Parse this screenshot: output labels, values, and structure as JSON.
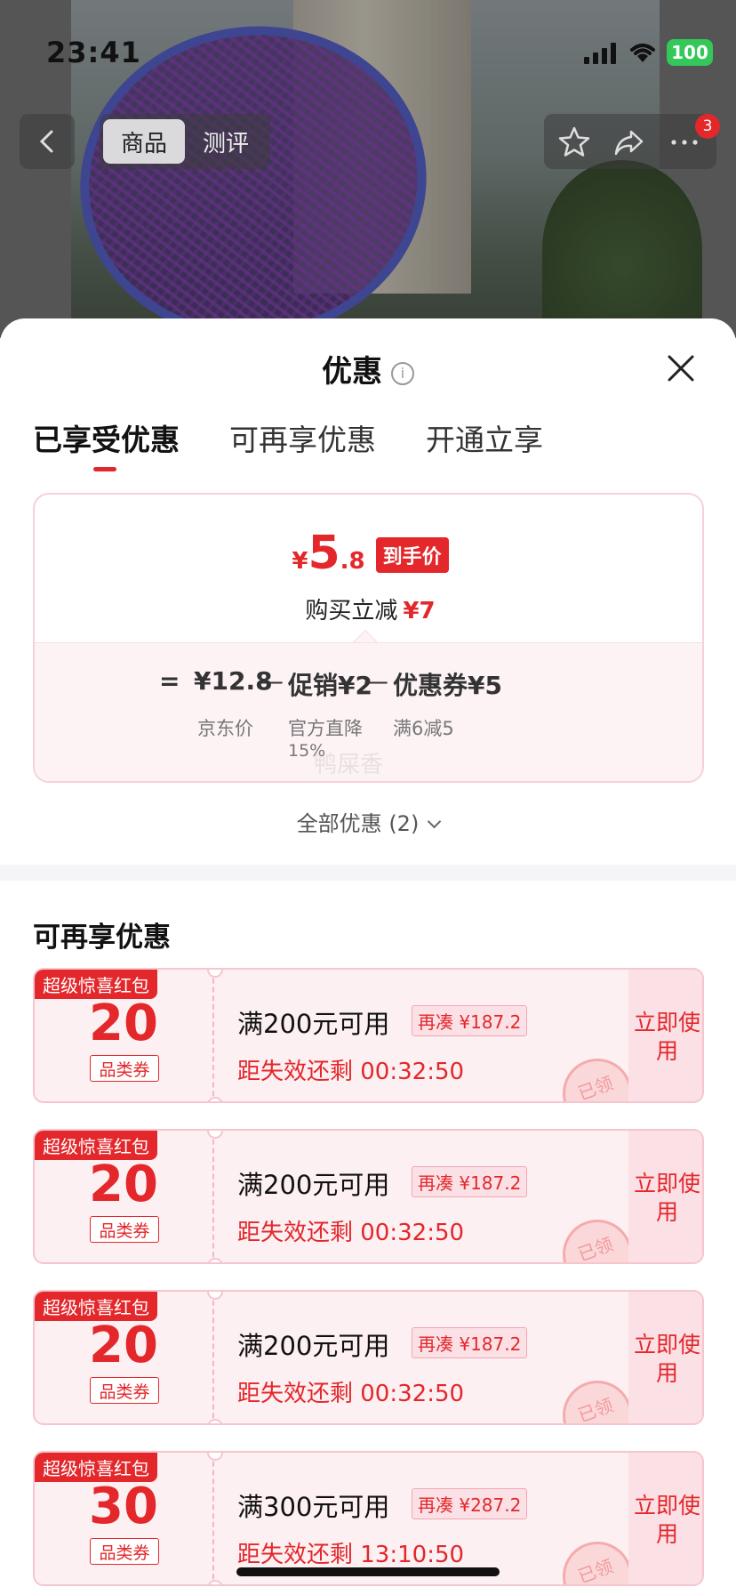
{
  "status_bar": {
    "time": "23:41",
    "battery": "100"
  },
  "nav": {
    "tabs": [
      {
        "label": "商品"
      },
      {
        "label": "测评"
      }
    ],
    "badge_count": "3",
    "icons": [
      "back-icon",
      "star-icon",
      "share-icon",
      "more-icon"
    ]
  },
  "sheet": {
    "title": "优惠",
    "tabs": [
      {
        "label": "已享受优惠"
      },
      {
        "label": "可再享优惠"
      },
      {
        "label": "开通立享"
      }
    ],
    "summary": {
      "price_yen": "¥",
      "price_int": "5",
      "price_dec": ".8",
      "price_tag": "到手价",
      "save_label": "购买立减",
      "save_amount": "¥7",
      "eq": "=",
      "base_price": "¥12.8",
      "minus1": "—",
      "promo": "促销¥2",
      "minus2": "—",
      "coupon": "优惠券¥5",
      "base_label": "京东价",
      "promo_label": "官方直降",
      "promo_pct": "15%",
      "coupon_label": "满6减5",
      "watermark": "鸭屎香"
    },
    "all_offers": "全部优惠 (2)",
    "section_title": "可再享优惠",
    "coupons": [
      {
        "flag": "超级惊喜红包",
        "amount": "20",
        "type": "品类券",
        "condition": "满200元可用",
        "need": "再凑 ¥187.2",
        "expire": "距失效还剩 00:32:50",
        "stamp": "已领",
        "button": "立即使用"
      },
      {
        "flag": "超级惊喜红包",
        "amount": "20",
        "type": "品类券",
        "condition": "满200元可用",
        "need": "再凑 ¥187.2",
        "expire": "距失效还剩 00:32:50",
        "stamp": "已领",
        "button": "立即使用"
      },
      {
        "flag": "超级惊喜红包",
        "amount": "20",
        "type": "品类券",
        "condition": "满200元可用",
        "need": "再凑 ¥187.2",
        "expire": "距失效还剩 00:32:50",
        "stamp": "已领",
        "button": "立即使用"
      },
      {
        "flag": "超级惊喜红包",
        "amount": "30",
        "type": "品类券",
        "condition": "满300元可用",
        "need": "再凑 ¥287.2",
        "expire": "距失效还剩 13:10:50",
        "stamp": "已领",
        "button": "立即使用"
      }
    ]
  },
  "colors": {
    "accent": "#e3272b",
    "coupon_bg": "#fdf0f2",
    "battery": "#34c759"
  }
}
